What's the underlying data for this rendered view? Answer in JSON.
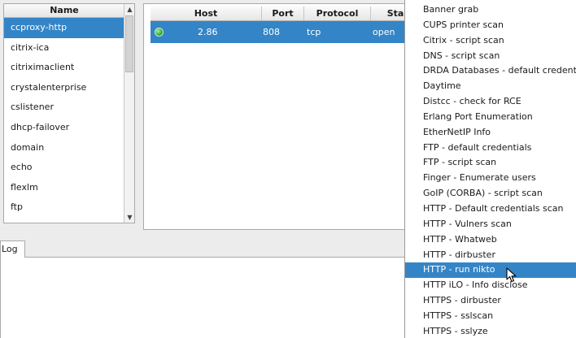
{
  "services": {
    "header": "Name",
    "selected_index": 0,
    "items": [
      "ccproxy-http",
      "citrix-ica",
      "citriximaclient",
      "crystalenterprise",
      "cslistener",
      "dhcp-failover",
      "domain",
      "echo",
      "flexlm",
      "ftp"
    ]
  },
  "hosts": {
    "headers": {
      "host": "Host",
      "port": "Port",
      "protocol": "Protocol",
      "state": "Sta"
    },
    "row": {
      "host": "2.86",
      "port": "808",
      "protocol": "tcp",
      "state": "open"
    }
  },
  "log": {
    "tab_label": "Log"
  },
  "context_menu": {
    "highlighted_index": 17,
    "items": [
      "Banner grab",
      "CUPS printer scan",
      "Citrix - script scan",
      "DNS - script scan",
      "DRDA Databases - default credentials",
      "Daytime",
      "Distcc - check for RCE",
      "Erlang Port Enumeration",
      "EtherNetIP Info",
      "FTP - default credentials",
      "FTP - script scan",
      "Finger - Enumerate users",
      "GoIP (CORBA) - script scan",
      "HTTP - Default credentials scan",
      "HTTP - Vulners scan",
      "HTTP - Whatweb",
      "HTTP - dirbuster",
      "HTTP - run nikto",
      "HTTP iLO - Info disclose",
      "HTTPS - dirbuster",
      "HTTPS - sslscan",
      "HTTPS - sslyze"
    ]
  },
  "colors": {
    "selection": "#3485c7",
    "status_ok": "#2fae2f"
  }
}
